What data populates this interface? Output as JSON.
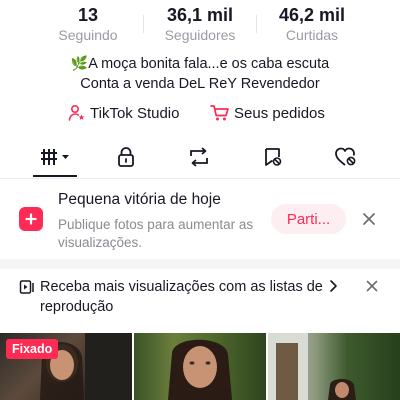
{
  "stats": [
    {
      "value": "13",
      "label": "Seguindo"
    },
    {
      "value": "36,1 mil",
      "label": "Seguidores"
    },
    {
      "value": "46,2 mil",
      "label": "Curtidas"
    }
  ],
  "bio": {
    "line1_emoji": "🌿",
    "line1": "A moça bonita fala...e os caba escuta",
    "line2": "Conta a venda DeL ReY Revendedor"
  },
  "links": {
    "studio": "TikTok Studio",
    "orders": "Seus pedidos"
  },
  "tabs": [
    {
      "icon": "grid-icon",
      "active": true
    },
    {
      "icon": "lock-icon",
      "active": false
    },
    {
      "icon": "repost-icon",
      "active": false
    },
    {
      "icon": "bookmark-icon",
      "active": false
    },
    {
      "icon": "liked-icon",
      "active": false
    }
  ],
  "banner1": {
    "title": "Pequena vitória de hoje",
    "subtitle": "Publique fotos para aumentar as visualizações.",
    "button": "Parti..."
  },
  "banner2": {
    "text": "Receba mais visualizações com as listas de reprodução"
  },
  "grid": {
    "pinned_label": "Fixado"
  },
  "colors": {
    "accent": "#fe2c55",
    "text": "#161823",
    "muted": "#9a9ca3"
  }
}
